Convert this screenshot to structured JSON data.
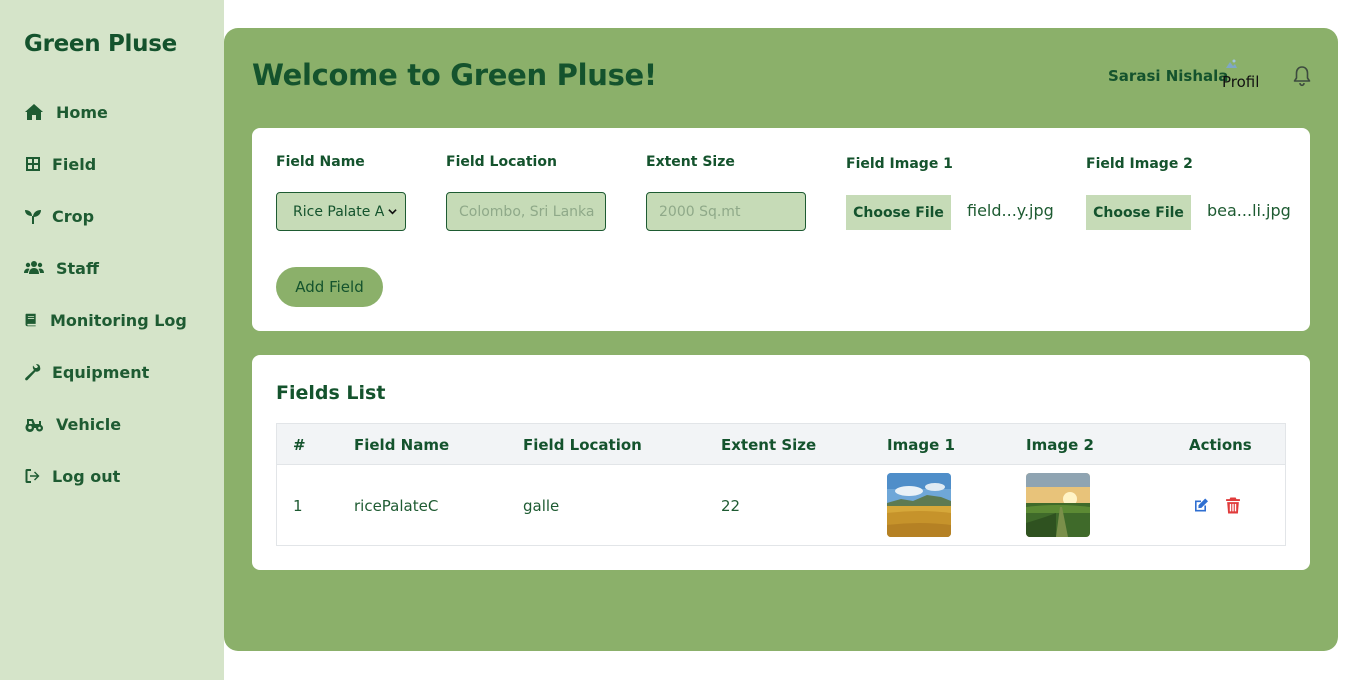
{
  "sidebar": {
    "brand": "Green Pluse",
    "items": [
      {
        "label": "Home",
        "icon": "home-icon"
      },
      {
        "label": "Field",
        "icon": "grid-icon"
      },
      {
        "label": "Crop",
        "icon": "seedling-icon"
      },
      {
        "label": "Staff",
        "icon": "users-icon"
      },
      {
        "label": "Monitoring Log",
        "icon": "book-icon"
      },
      {
        "label": "Equipment",
        "icon": "wrench-icon"
      },
      {
        "label": "Vehicle",
        "icon": "tractor-icon"
      },
      {
        "label": "Log out",
        "icon": "logout-icon"
      }
    ]
  },
  "header": {
    "title": "Welcome to Green Pluse!",
    "user_name": "Sarasi Nishala",
    "avatar_alt": "Profile",
    "notification_icon": "bell-icon"
  },
  "form": {
    "field_name_label": "Field Name",
    "field_name_value": "Rice Palate A",
    "field_location_label": "Field Location",
    "field_location_placeholder": "Colombo, Sri Lanka",
    "extent_size_label": "Extent Size",
    "extent_size_placeholder": "2000 Sq.mt",
    "image1_label": "Field Image 1",
    "image1_button": "Choose File",
    "image1_file": "field...y.jpg",
    "image2_label": "Field Image 2",
    "image2_button": "Choose File",
    "image2_file": "bea...li.jpg",
    "submit_label": "Add Field"
  },
  "fields_list": {
    "title": "Fields List",
    "columns": [
      "#",
      "Field Name",
      "Field Location",
      "Extent Size",
      "Image 1",
      "Image 2",
      "Actions"
    ],
    "rows": [
      {
        "index": "1",
        "name": "ricePalateC",
        "location": "galle",
        "extent": "22"
      }
    ]
  },
  "colors": {
    "sidebar_bg": "#d5e4c9",
    "main_bg": "#8bb06a",
    "text_dark_green": "#14532d",
    "input_bg": "#c6dbb7",
    "edit_blue": "#2f6fd1",
    "delete_red": "#e03b3b"
  }
}
